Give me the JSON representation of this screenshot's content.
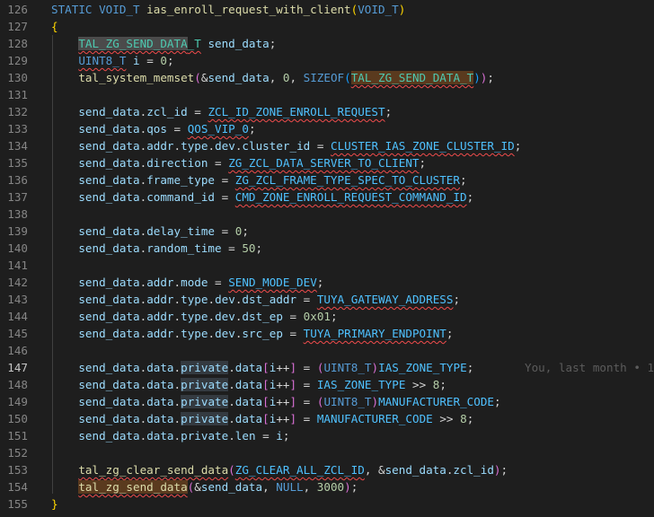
{
  "editor": {
    "lines": [
      {
        "n": "126",
        "tokens": [
          {
            "t": "STATIC VOID_T ",
            "c": "kw"
          },
          {
            "t": "ias_enroll_request_with_client",
            "c": "fn"
          },
          {
            "t": "(",
            "c": "br1"
          },
          {
            "t": "VOID_T",
            "c": "kw"
          },
          {
            "t": ")",
            "c": "br1"
          }
        ]
      },
      {
        "n": "127",
        "tokens": [
          {
            "t": "{",
            "c": "br1"
          }
        ]
      },
      {
        "n": "128",
        "tokens": [
          {
            "t": "    "
          },
          {
            "t": "TAL_ZG_SEND_DATA",
            "c": "ty",
            "h": "gray",
            "sq": 1
          },
          {
            "t": "_T",
            "c": "ty",
            "sq": 1
          },
          {
            "t": " "
          },
          {
            "t": "send_data",
            "c": "var"
          },
          {
            "t": ";"
          }
        ]
      },
      {
        "n": "129",
        "tokens": [
          {
            "t": "    "
          },
          {
            "t": "UINT8_T",
            "c": "kw",
            "sq": 1
          },
          {
            "t": " "
          },
          {
            "t": "i",
            "c": "var"
          },
          {
            "t": " = "
          },
          {
            "t": "0",
            "c": "num"
          },
          {
            "t": ";"
          }
        ]
      },
      {
        "n": "130",
        "tokens": [
          {
            "t": "    "
          },
          {
            "t": "tal_system_memset",
            "c": "fn"
          },
          {
            "t": "(",
            "c": "br2"
          },
          {
            "t": "&"
          },
          {
            "t": "send_data",
            "c": "var"
          },
          {
            "t": ", "
          },
          {
            "t": "0",
            "c": "num"
          },
          {
            "t": ", "
          },
          {
            "t": "SIZEOF",
            "c": "kw"
          },
          {
            "t": "(",
            "c": "br3"
          },
          {
            "t": "TAL_ZG_SEND_DATA_T",
            "c": "ty",
            "h": "brown",
            "sq": 1
          },
          {
            "t": ")",
            "c": "br3"
          },
          {
            "t": ")",
            "c": "br2"
          },
          {
            "t": ";"
          }
        ]
      },
      {
        "n": "131",
        "tokens": []
      },
      {
        "n": "132",
        "tokens": [
          {
            "t": "    "
          },
          {
            "t": "send_data",
            "c": "var"
          },
          {
            "t": "."
          },
          {
            "t": "zcl_id",
            "c": "var"
          },
          {
            "t": " = "
          },
          {
            "t": "ZCL_ID_ZONE_ENROLL_REQUEST",
            "c": "mac",
            "sq": 1
          },
          {
            "t": ";"
          }
        ]
      },
      {
        "n": "133",
        "tokens": [
          {
            "t": "    "
          },
          {
            "t": "send_data",
            "c": "var"
          },
          {
            "t": "."
          },
          {
            "t": "qos",
            "c": "var"
          },
          {
            "t": " = "
          },
          {
            "t": "QOS_VIP_0",
            "c": "mac",
            "sq": 1
          },
          {
            "t": ";"
          }
        ]
      },
      {
        "n": "134",
        "tokens": [
          {
            "t": "    "
          },
          {
            "t": "send_data",
            "c": "var"
          },
          {
            "t": "."
          },
          {
            "t": "addr",
            "c": "var"
          },
          {
            "t": "."
          },
          {
            "t": "type",
            "c": "var"
          },
          {
            "t": "."
          },
          {
            "t": "dev",
            "c": "var"
          },
          {
            "t": "."
          },
          {
            "t": "cluster_id",
            "c": "var"
          },
          {
            "t": " = "
          },
          {
            "t": "CLUSTER_IAS_ZONE_CLUSTER_ID",
            "c": "mac",
            "sq": 1
          },
          {
            "t": ";"
          }
        ]
      },
      {
        "n": "135",
        "tokens": [
          {
            "t": "    "
          },
          {
            "t": "send_data",
            "c": "var"
          },
          {
            "t": "."
          },
          {
            "t": "direction",
            "c": "var"
          },
          {
            "t": " = "
          },
          {
            "t": "ZG_ZCL_DATA_SERVER_TO_CLIENT",
            "c": "mac",
            "sq": 1
          },
          {
            "t": ";"
          }
        ]
      },
      {
        "n": "136",
        "tokens": [
          {
            "t": "    "
          },
          {
            "t": "send_data",
            "c": "var"
          },
          {
            "t": "."
          },
          {
            "t": "frame_type",
            "c": "var"
          },
          {
            "t": " = "
          },
          {
            "t": "ZG_ZCL_FRAME_TYPE_SPEC_TO_CLUSTER",
            "c": "mac",
            "sq": 1
          },
          {
            "t": ";"
          }
        ]
      },
      {
        "n": "137",
        "tokens": [
          {
            "t": "    "
          },
          {
            "t": "send_data",
            "c": "var"
          },
          {
            "t": "."
          },
          {
            "t": "command_id",
            "c": "var"
          },
          {
            "t": " = "
          },
          {
            "t": "CMD_ZONE_ENROLL_REQUEST_COMMAND_ID",
            "c": "mac",
            "sq": 1
          },
          {
            "t": ";"
          }
        ]
      },
      {
        "n": "138",
        "tokens": []
      },
      {
        "n": "139",
        "tokens": [
          {
            "t": "    "
          },
          {
            "t": "send_data",
            "c": "var"
          },
          {
            "t": "."
          },
          {
            "t": "delay_time",
            "c": "var"
          },
          {
            "t": " = "
          },
          {
            "t": "0",
            "c": "num"
          },
          {
            "t": ";"
          }
        ]
      },
      {
        "n": "140",
        "tokens": [
          {
            "t": "    "
          },
          {
            "t": "send_data",
            "c": "var"
          },
          {
            "t": "."
          },
          {
            "t": "random_time",
            "c": "var"
          },
          {
            "t": " = "
          },
          {
            "t": "50",
            "c": "num"
          },
          {
            "t": ";"
          }
        ]
      },
      {
        "n": "141",
        "tokens": []
      },
      {
        "n": "142",
        "tokens": [
          {
            "t": "    "
          },
          {
            "t": "send_data",
            "c": "var"
          },
          {
            "t": "."
          },
          {
            "t": "addr",
            "c": "var"
          },
          {
            "t": "."
          },
          {
            "t": "mode",
            "c": "var"
          },
          {
            "t": " = "
          },
          {
            "t": "SEND_MODE_DEV",
            "c": "mac",
            "sq": 1
          },
          {
            "t": ";"
          }
        ]
      },
      {
        "n": "143",
        "tokens": [
          {
            "t": "    "
          },
          {
            "t": "send_data",
            "c": "var"
          },
          {
            "t": "."
          },
          {
            "t": "addr",
            "c": "var"
          },
          {
            "t": "."
          },
          {
            "t": "type",
            "c": "var"
          },
          {
            "t": "."
          },
          {
            "t": "dev",
            "c": "var"
          },
          {
            "t": "."
          },
          {
            "t": "dst_addr",
            "c": "var"
          },
          {
            "t": " = "
          },
          {
            "t": "TUYA_GATEWAY_ADDRESS",
            "c": "mac",
            "sq": 1
          },
          {
            "t": ";"
          }
        ]
      },
      {
        "n": "144",
        "tokens": [
          {
            "t": "    "
          },
          {
            "t": "send_data",
            "c": "var"
          },
          {
            "t": "."
          },
          {
            "t": "addr",
            "c": "var"
          },
          {
            "t": "."
          },
          {
            "t": "type",
            "c": "var"
          },
          {
            "t": "."
          },
          {
            "t": "dev",
            "c": "var"
          },
          {
            "t": "."
          },
          {
            "t": "dst_ep",
            "c": "var"
          },
          {
            "t": " = "
          },
          {
            "t": "0x01",
            "c": "num"
          },
          {
            "t": ";"
          }
        ]
      },
      {
        "n": "145",
        "tokens": [
          {
            "t": "    "
          },
          {
            "t": "send_data",
            "c": "var"
          },
          {
            "t": "."
          },
          {
            "t": "addr",
            "c": "var"
          },
          {
            "t": "."
          },
          {
            "t": "type",
            "c": "var"
          },
          {
            "t": "."
          },
          {
            "t": "dev",
            "c": "var"
          },
          {
            "t": "."
          },
          {
            "t": "src_ep",
            "c": "var"
          },
          {
            "t": " = "
          },
          {
            "t": "TUYA_PRIMARY_ENDPOINT",
            "c": "mac",
            "sq": 1
          },
          {
            "t": ";"
          }
        ]
      },
      {
        "n": "146",
        "tokens": []
      },
      {
        "n": "147",
        "current": true,
        "blame": "You, last month • 1",
        "tokens": [
          {
            "t": "    "
          },
          {
            "t": "send_data",
            "c": "var"
          },
          {
            "t": "."
          },
          {
            "t": "data",
            "c": "var"
          },
          {
            "t": "."
          },
          {
            "t": "private",
            "c": "var",
            "h": "word"
          },
          {
            "t": "."
          },
          {
            "t": "data",
            "c": "var"
          },
          {
            "t": "[",
            "c": "br2"
          },
          {
            "t": "i",
            "c": "var"
          },
          {
            "t": "++"
          },
          {
            "t": "]",
            "c": "br2"
          },
          {
            "t": " = "
          },
          {
            "t": "(",
            "c": "br2"
          },
          {
            "t": "UINT8_T",
            "c": "kw"
          },
          {
            "t": ")",
            "c": "br2"
          },
          {
            "t": "IAS_ZONE_TYPE",
            "c": "mac"
          },
          {
            "t": ";"
          }
        ]
      },
      {
        "n": "148",
        "tokens": [
          {
            "t": "    "
          },
          {
            "t": "send_data",
            "c": "var"
          },
          {
            "t": "."
          },
          {
            "t": "data",
            "c": "var"
          },
          {
            "t": "."
          },
          {
            "t": "private",
            "c": "var",
            "h": "word"
          },
          {
            "t": "."
          },
          {
            "t": "data",
            "c": "var"
          },
          {
            "t": "[",
            "c": "br2"
          },
          {
            "t": "i",
            "c": "var"
          },
          {
            "t": "++"
          },
          {
            "t": "]",
            "c": "br2"
          },
          {
            "t": " = "
          },
          {
            "t": "IAS_ZONE_TYPE",
            "c": "mac"
          },
          {
            "t": " >> "
          },
          {
            "t": "8",
            "c": "num"
          },
          {
            "t": ";"
          }
        ]
      },
      {
        "n": "149",
        "tokens": [
          {
            "t": "    "
          },
          {
            "t": "send_data",
            "c": "var"
          },
          {
            "t": "."
          },
          {
            "t": "data",
            "c": "var"
          },
          {
            "t": "."
          },
          {
            "t": "private",
            "c": "var",
            "h": "word"
          },
          {
            "t": "."
          },
          {
            "t": "data",
            "c": "var"
          },
          {
            "t": "[",
            "c": "br2"
          },
          {
            "t": "i",
            "c": "var"
          },
          {
            "t": "++"
          },
          {
            "t": "]",
            "c": "br2"
          },
          {
            "t": " = "
          },
          {
            "t": "(",
            "c": "br2"
          },
          {
            "t": "UINT8_T",
            "c": "kw"
          },
          {
            "t": ")",
            "c": "br2"
          },
          {
            "t": "MANUFACTURER_CODE",
            "c": "mac"
          },
          {
            "t": ";"
          }
        ]
      },
      {
        "n": "150",
        "tokens": [
          {
            "t": "    "
          },
          {
            "t": "send_data",
            "c": "var"
          },
          {
            "t": "."
          },
          {
            "t": "data",
            "c": "var"
          },
          {
            "t": "."
          },
          {
            "t": "private",
            "c": "var",
            "h": "word"
          },
          {
            "t": "."
          },
          {
            "t": "data",
            "c": "var"
          },
          {
            "t": "[",
            "c": "br2"
          },
          {
            "t": "i",
            "c": "var"
          },
          {
            "t": "++"
          },
          {
            "t": "]",
            "c": "br2"
          },
          {
            "t": " = "
          },
          {
            "t": "MANUFACTURER_CODE",
            "c": "mac"
          },
          {
            "t": " >> "
          },
          {
            "t": "8",
            "c": "num"
          },
          {
            "t": ";"
          }
        ]
      },
      {
        "n": "151",
        "tokens": [
          {
            "t": "    "
          },
          {
            "t": "send_data",
            "c": "var"
          },
          {
            "t": "."
          },
          {
            "t": "data",
            "c": "var"
          },
          {
            "t": "."
          },
          {
            "t": "private",
            "c": "var"
          },
          {
            "t": "."
          },
          {
            "t": "len",
            "c": "var"
          },
          {
            "t": " = "
          },
          {
            "t": "i",
            "c": "var"
          },
          {
            "t": ";"
          }
        ]
      },
      {
        "n": "152",
        "tokens": []
      },
      {
        "n": "153",
        "tokens": [
          {
            "t": "    "
          },
          {
            "t": "tal_zg_clear_send_data",
            "c": "fn",
            "sq": 1
          },
          {
            "t": "(",
            "c": "br2"
          },
          {
            "t": "ZG_CLEAR_ALL_ZCL_ID",
            "c": "mac",
            "sq": 1
          },
          {
            "t": ", "
          },
          {
            "t": "&"
          },
          {
            "t": "send_data",
            "c": "var"
          },
          {
            "t": "."
          },
          {
            "t": "zcl_id",
            "c": "var"
          },
          {
            "t": ")",
            "c": "br2"
          },
          {
            "t": ";"
          }
        ]
      },
      {
        "n": "154",
        "tokens": [
          {
            "t": "    "
          },
          {
            "t": "tal_zg_send_data",
            "c": "fn",
            "h": "brown",
            "sq": 1
          },
          {
            "t": "(",
            "c": "br2"
          },
          {
            "t": "&"
          },
          {
            "t": "send_data",
            "c": "var"
          },
          {
            "t": ", "
          },
          {
            "t": "NULL",
            "c": "kw"
          },
          {
            "t": ", "
          },
          {
            "t": "3000",
            "c": "num"
          },
          {
            "t": ")",
            "c": "br2"
          },
          {
            "t": ";"
          }
        ]
      },
      {
        "n": "155",
        "tokens": [
          {
            "t": "}",
            "c": "br1"
          }
        ]
      }
    ]
  }
}
